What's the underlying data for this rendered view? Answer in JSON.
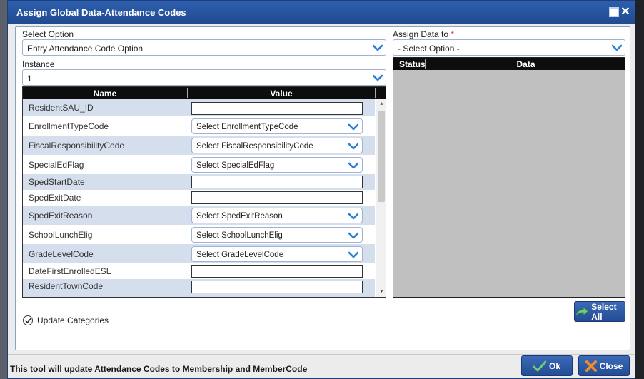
{
  "dialog": {
    "title": "Assign Global Data-Attendance Codes"
  },
  "select_option": {
    "label": "Select Option",
    "value": "Entry Attendance Code Option"
  },
  "instance": {
    "label": "Instance",
    "value": "1"
  },
  "assign_data_to": {
    "label": "Assign Data to",
    "required_mark": "*",
    "value": "- Select Option -"
  },
  "grid": {
    "headers": {
      "name": "Name",
      "value": "Value"
    },
    "rows": [
      {
        "name": "ResidentSAU_ID",
        "type": "text",
        "value": ""
      },
      {
        "name": "EnrollmentTypeCode",
        "type": "select",
        "value": "Select EnrollmentTypeCode"
      },
      {
        "name": "FiscalResponsibilityCode",
        "type": "select",
        "value": "Select FiscalResponsibilityCode"
      },
      {
        "name": "SpecialEdFlag",
        "type": "select",
        "value": "Select SpecialEdFlag"
      },
      {
        "name": "SpedStartDate",
        "type": "text",
        "value": ""
      },
      {
        "name": "SpedExitDate",
        "type": "text",
        "value": ""
      },
      {
        "name": "SpedExitReason",
        "type": "select",
        "value": "Select SpedExitReason"
      },
      {
        "name": "SchoolLunchElig",
        "type": "select",
        "value": "Select SchoolLunchElig"
      },
      {
        "name": "GradeLevelCode",
        "type": "select",
        "value": "Select GradeLevelCode"
      },
      {
        "name": "DateFirstEnrolledESL",
        "type": "text",
        "value": ""
      },
      {
        "name": "ResidentTownCode",
        "type": "text",
        "value": ""
      }
    ]
  },
  "right_panel": {
    "headers": {
      "status": "Status",
      "data": "Data"
    }
  },
  "update_categories": {
    "label": "Update Categories",
    "checked": true
  },
  "buttons": {
    "select_all": "Select All",
    "ok": "Ok",
    "close": "Close"
  },
  "footer": {
    "message": "This tool will update Attendance Codes to Membership and MemberCode"
  },
  "colors": {
    "title_bar": "#2d5fae",
    "row_alt": "#d5deec",
    "button": "#3b6ab8",
    "chevron": "#2b7fd6",
    "ok_check": "#6fd16b",
    "close_x": "#f08a2c",
    "required": "#e03a2f"
  }
}
